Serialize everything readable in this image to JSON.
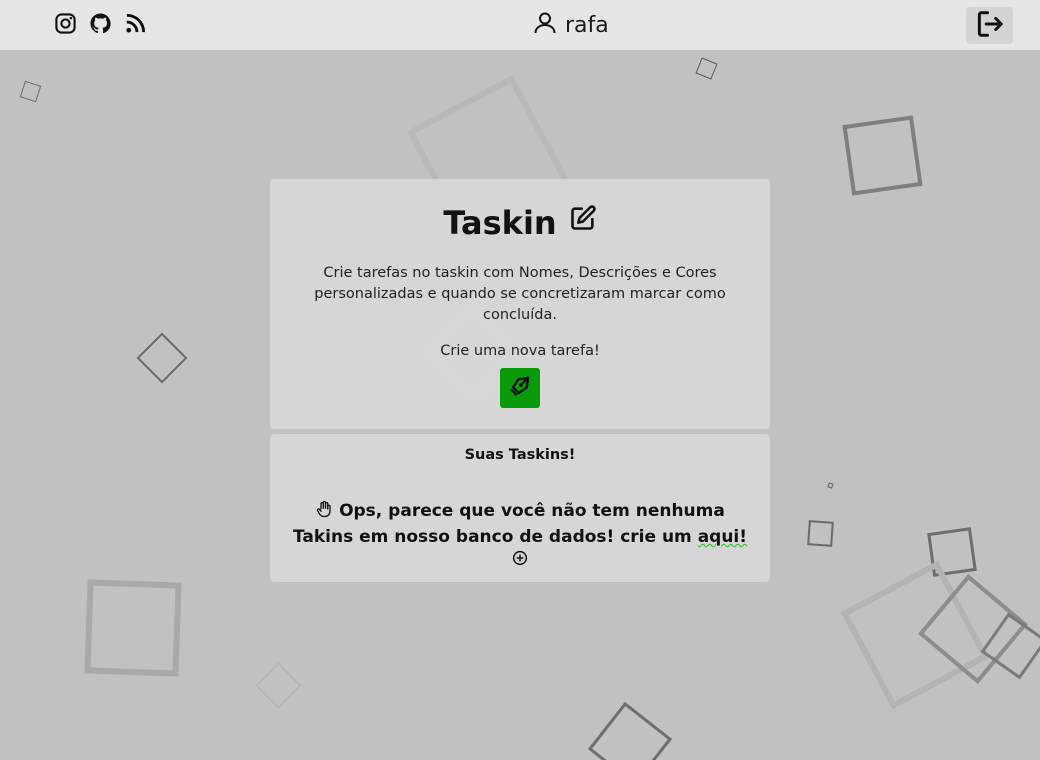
{
  "header": {
    "social": [
      {
        "icon": "instagram-icon"
      },
      {
        "icon": "github-icon"
      },
      {
        "icon": "rss-icon"
      }
    ],
    "user": {
      "icon": "user-icon",
      "name": "rafa"
    },
    "logout": {
      "icon": "logout-icon"
    }
  },
  "intro": {
    "title": "Taskin",
    "title_icon": "edit-icon",
    "description": "Crie tarefas no taskin com Nomes, Descrições e Cores personalizadas e quando se concretizaram marcar como concluída.",
    "cta": "Crie uma nova tarefa!",
    "new_button_icon": "pen-nib-icon"
  },
  "tasks": {
    "title": "Suas Taskins!",
    "empty_text": "Ops, parece que você não tem nenhuma Takins em nosso banco de dados! crie um",
    "link": "aqui!",
    "hand_icon": "hand-icon",
    "add_icon": "plus-circle-icon"
  },
  "colors": {
    "background": "#c1c1c1",
    "header": "#e6e6e6",
    "card": "#d8d8d8",
    "accent": "#0a9b0a",
    "link_underline": "#22c322"
  }
}
